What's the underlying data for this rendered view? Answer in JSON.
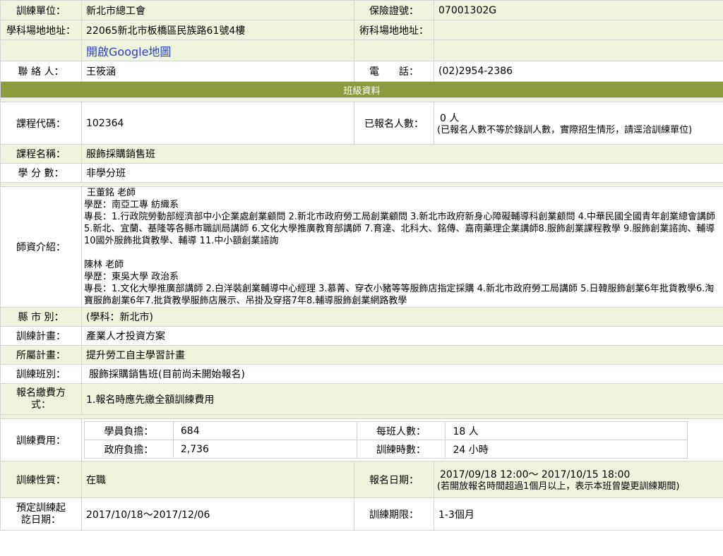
{
  "unit": {
    "label": "訓練單位：",
    "value": "新北市總工會"
  },
  "insurance": {
    "label": "保險證號：",
    "value": "07001302G"
  },
  "academic_site": {
    "label": "學科場地地址：",
    "value": "22065新北市板橋區民族路61號4樓",
    "map_link": "開啟Google地圖"
  },
  "technical_site": {
    "label": "術科場地地址：",
    "value": ""
  },
  "contact": {
    "label": "聯 絡 人：",
    "value": "王筱涵"
  },
  "phone": {
    "label": "電　　話：",
    "value": "(02)2954-2386"
  },
  "section_title": "班級資料",
  "course_code": {
    "label": "課程代碼：",
    "value": "102364"
  },
  "enrolled": {
    "label": "已報名人數：",
    "value": "0 人",
    "note": "(已報名人數不等於錄訓人數，實際招生情形，請逕洽訓練單位)"
  },
  "course_name": {
    "label": "課程名稱：",
    "value": "服飾採購銷售班"
  },
  "credits": {
    "label": "學 分 數：",
    "value": "非學分班"
  },
  "teachers": {
    "label": "師資介紹：",
    "t1_name": "王董銘 老師",
    "t1_edu": "學歷：南亞工專 紡織系",
    "t1_exp": "專長：1.行政院勞動部經濟部中小企業處創業顧問 2.新北市政府勞工局創業顧問 3.新北市政府新身心障礙輔導科創業顧問 4.中華民國全國青年創業總會講師 5.新北、宜蘭、基隆等各縣市職訓局講師 6.文化大學推廣教育部講師 7.育達、北科大、銘傳、嘉南藥理企業講師8.服飾創業課程教學 9.服飾創業諮詢、輔導 10國外服飾批貨教學、輔導 11.中小額創業諮詢",
    "t2_name": "陳林 老師",
    "t2_edu": "學歷：東吳大學 政治系",
    "t2_exp": "專長：1.文化大學推廣部講師 2.白洋裝創業輔導中心經理 3.慕菁、穿衣小豬等等服飾店指定採購 4.新北市政府勞工局講師 5.日韓服飾創業6年批貨教學6.淘寶服飾創業6年7.批貨教學服飾店展示、吊掛及穿搭7年8.輔導服飾創業網路教學"
  },
  "county": {
    "label": "縣 市 別：",
    "value": "(學科：新北市)"
  },
  "plan": {
    "label": "訓練計畫：",
    "value": "產業人才投資方案"
  },
  "sub_plan": {
    "label": "所屬計畫：",
    "value": "提升勞工自主學習計畫"
  },
  "class": {
    "label": "訓練班別：",
    "value": "服飾採購銷售班(目前尚未開始報名)"
  },
  "payment": {
    "label": "報名繳費方式：",
    "value": "1.報名時應先繳全額訓練費用"
  },
  "fee": {
    "label": "訓練費用：",
    "student_label": "學員負擔：",
    "student_value": "684",
    "class_size_label": "每班人數：",
    "class_size_value": "18 人",
    "gov_label": "政府負擔：",
    "gov_value": "2,736",
    "hours_label": "訓練時數：",
    "hours_value": "24 小時"
  },
  "nature": {
    "label": "訓練性質：",
    "value": "在職"
  },
  "signup_date": {
    "label": "報名日期：",
    "value": "2017/09/18 12:00～ 2017/10/15 18:00",
    "note": "(若開放報名時間超過1個月以上，表示本班曾變更訓練期間)"
  },
  "training_date": {
    "label": "預定訓練起訖日期：",
    "value": "2017/10/18～2017/12/06"
  },
  "duration": {
    "label": "訓練期限：",
    "value": "1-3個月"
  }
}
